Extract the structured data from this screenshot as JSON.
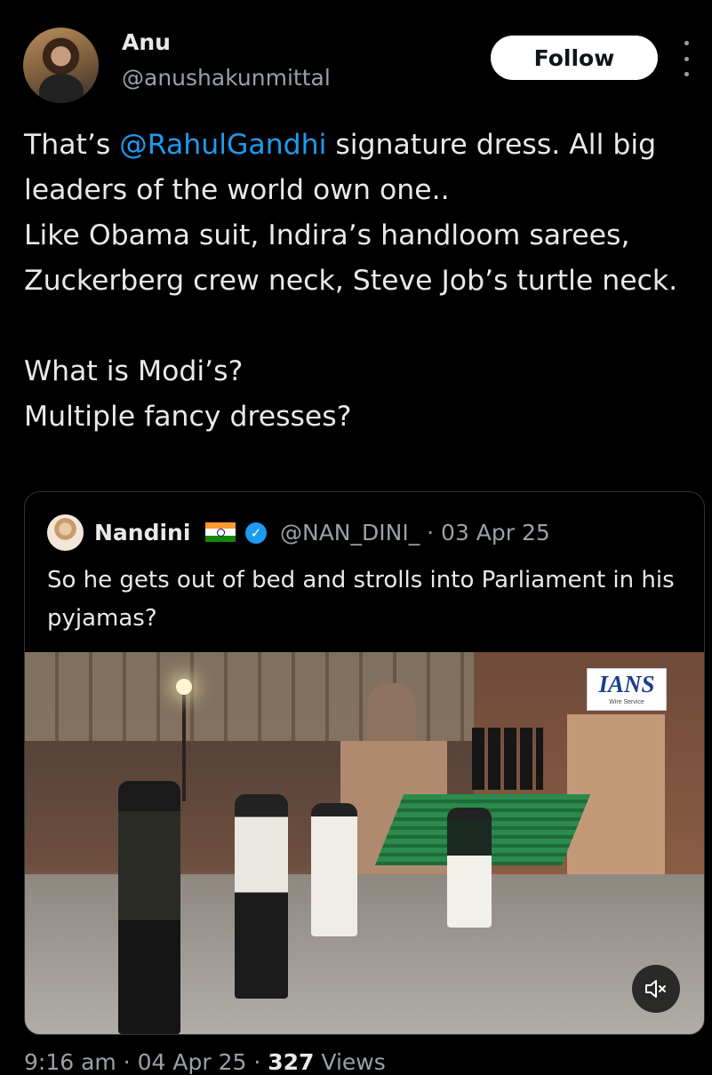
{
  "tweet": {
    "author_name": "Anu",
    "author_handle": "@anushakunmittal",
    "follow_label": "Follow",
    "text_before_mention": "That’s ",
    "mention": "@RahulGandhi",
    "text_after_mention": " signature dress. All big leaders of the world own one..\nLike Obama suit, Indira’s handloom sarees, Zuckerberg crew neck, Steve Job’s turtle neck.\n\nWhat is Modi’s?\nMultiple fancy dresses?"
  },
  "quote": {
    "author_name": "Nandini",
    "flag_emoji": "🇮🇳",
    "verified": true,
    "handle_and_date": "@NAN_DINI_ · 03 Apr 25",
    "text": "So he gets out of bed and strolls into Parliament in his pyjamas?",
    "media": {
      "watermark": "IANS",
      "watermark_sub": "Wire Service",
      "mute_icon": "speaker-muted-icon"
    }
  },
  "footer": {
    "time": "9:16 am",
    "date": "04 Apr 25",
    "views_count": "327",
    "views_label": "Views"
  },
  "colors": {
    "background": "#000000",
    "text": "#e7e9ea",
    "secondary": "#9aa0a6",
    "accent": "#1d9bf0"
  }
}
